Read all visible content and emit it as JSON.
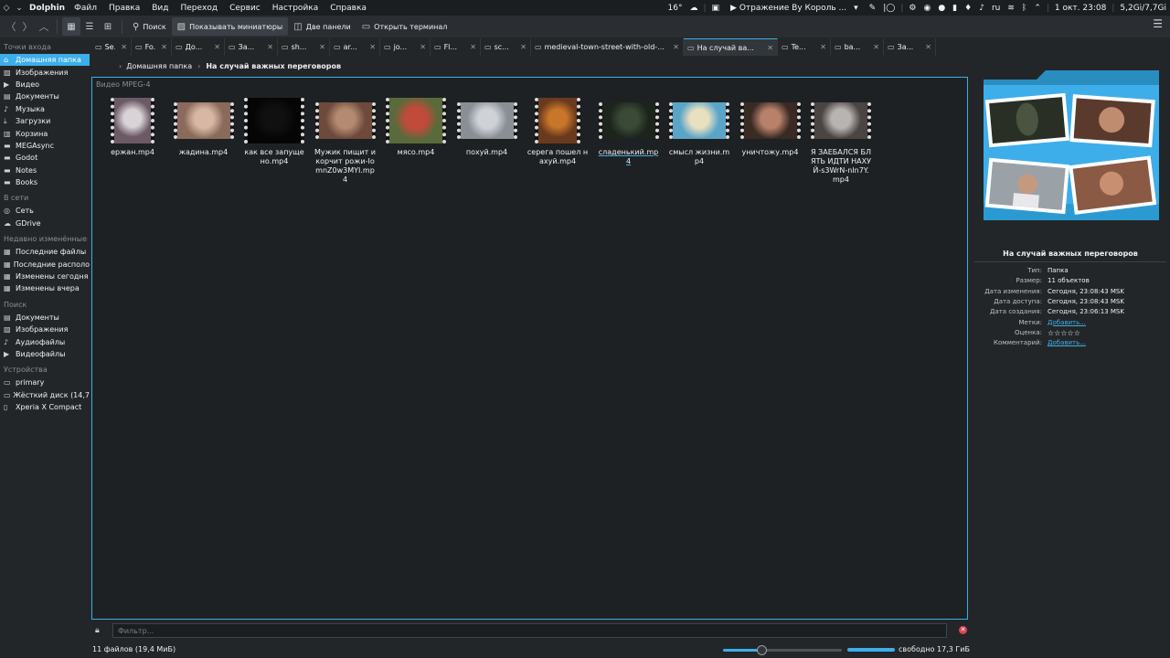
{
  "topbar": {
    "app_name": "Dolphin",
    "menus": [
      "Файл",
      "Правка",
      "Вид",
      "Переход",
      "Сервис",
      "Настройка",
      "Справка"
    ],
    "temperature": "16°",
    "media_title": "▶ Отражение By Король ...",
    "keyboard_layout": "ru",
    "datetime": "1 окт. 23:08",
    "memory": "5,2Gi/7,7Gi"
  },
  "toolbar": {
    "search_label": "Поиск",
    "thumbnails_label": "Показывать миниатюры",
    "split_label": "Две панели",
    "terminal_label": "Открыть терминал"
  },
  "sidebar": {
    "sections": [
      {
        "title": "Точки входа",
        "items": [
          {
            "label": "Домашняя папка",
            "icon": "home-icon",
            "selected": true
          },
          {
            "label": "Изображения",
            "icon": "image-icon"
          },
          {
            "label": "Видео",
            "icon": "video-icon"
          },
          {
            "label": "Документы",
            "icon": "document-icon"
          },
          {
            "label": "Музыка",
            "icon": "music-icon"
          },
          {
            "label": "Загрузки",
            "icon": "download-icon"
          },
          {
            "label": "Корзина",
            "icon": "trash-icon"
          },
          {
            "label": "MEGAsync",
            "icon": "folder-icon"
          },
          {
            "label": "Godot",
            "icon": "folder-icon"
          },
          {
            "label": "Notes",
            "icon": "folder-icon"
          },
          {
            "label": "Books",
            "icon": "folder-icon"
          }
        ]
      },
      {
        "title": "В сети",
        "items": [
          {
            "label": "Сеть",
            "icon": "network-icon"
          },
          {
            "label": "GDrive",
            "icon": "cloud-icon"
          }
        ]
      },
      {
        "title": "Недавно изменённые",
        "items": [
          {
            "label": "Последние файлы",
            "icon": "recent-files-icon"
          },
          {
            "label": "Последние располо",
            "icon": "recent-locations-icon"
          },
          {
            "label": "Изменены сегодня",
            "icon": "calendar-icon"
          },
          {
            "label": "Изменены вчера",
            "icon": "calendar-icon"
          }
        ]
      },
      {
        "title": "Поиск",
        "items": [
          {
            "label": "Документы",
            "icon": "document-icon"
          },
          {
            "label": "Изображения",
            "icon": "image-icon"
          },
          {
            "label": "Аудиофайлы",
            "icon": "music-icon"
          },
          {
            "label": "Видеофайлы",
            "icon": "video-icon"
          }
        ]
      },
      {
        "title": "Устройства",
        "items": [
          {
            "label": "primary",
            "icon": "drive-icon"
          },
          {
            "label": "Жёсткий диск (14,7",
            "icon": "drive-icon"
          },
          {
            "label": "Xperia X Compact",
            "icon": "phone-icon"
          }
        ]
      }
    ]
  },
  "tabs": [
    {
      "label": "Se...",
      "active": false
    },
    {
      "label": "Fo...",
      "active": false
    },
    {
      "label": "До...",
      "active": false
    },
    {
      "label": "За...",
      "active": false
    },
    {
      "label": "sh...",
      "active": false
    },
    {
      "label": "ar...",
      "active": false
    },
    {
      "label": "jo...",
      "active": false
    },
    {
      "label": "Fl...",
      "active": false
    },
    {
      "label": "sc...",
      "active": false
    },
    {
      "label": "medieval-town-street-with-old-...",
      "active": false
    },
    {
      "label": "На случай ва...",
      "active": true
    },
    {
      "label": "Te...",
      "active": false
    },
    {
      "label": "ba...",
      "active": false
    },
    {
      "label": "За...",
      "active": false
    }
  ],
  "breadcrumb": {
    "home": "Домашняя папка",
    "current": "На случай важных переговоров"
  },
  "main": {
    "group_label": "Видео MPEG-4",
    "files": [
      {
        "name": "ержан.mp4",
        "colors": [
          "#6b5a66",
          "#d9d2d6"
        ]
      },
      {
        "name": "жадина.mp4",
        "colors": [
          "#8a6a5a",
          "#d8b8a4"
        ]
      },
      {
        "name": "как все запущено.mp4",
        "colors": [
          "#050505",
          "#101010"
        ]
      },
      {
        "name": "Мужик пищит и корчит рожи-IomnZ0w3MYI.mp4",
        "colors": [
          "#6d4a3c",
          "#b58a72"
        ]
      },
      {
        "name": "мясо.mp4",
        "colors": [
          "#5a6a3a",
          "#c24a3a"
        ]
      },
      {
        "name": "похуй.mp4",
        "colors": [
          "#8a8f96",
          "#cfd3d8"
        ]
      },
      {
        "name": "серега пошел нахуй.mp4",
        "colors": [
          "#6a3a1e",
          "#c8762a"
        ]
      },
      {
        "name": "сладенький.mp4",
        "colors": [
          "#1c241c",
          "#3a4a36"
        ],
        "hover": true
      },
      {
        "name": "смысл жизни.mp4",
        "colors": [
          "#5aa4c8",
          "#e8e0c0"
        ]
      },
      {
        "name": "уничтожу.mp4",
        "colors": [
          "#3a2a24",
          "#b8826a"
        ]
      },
      {
        "name": "Я ЗАЕБАЛСЯ БЛЯТЬ ИДТИ НАХУЙ-s3WrN-nIn7Y.mp4",
        "colors": [
          "#4a4442",
          "#b8b4b2"
        ]
      }
    ]
  },
  "filter": {
    "placeholder": "Фильтр..."
  },
  "status": {
    "summary": "11 файлов (19,4 МиБ)",
    "free_space": "свободно 17,3 ГиБ",
    "zoom_fraction": 0.32,
    "free_fraction": 0.7
  },
  "info": {
    "title": "На случай важных переговоров",
    "rows": [
      {
        "label": "Тип:",
        "value": "Папка"
      },
      {
        "label": "Размер:",
        "value": "11 объектов"
      },
      {
        "label": "Дата изменения:",
        "value": "Сегодня, 23:08:43 MSK"
      },
      {
        "label": "Дата доступа:",
        "value": "Сегодня, 23:08:43 MSK"
      },
      {
        "label": "Дата создания:",
        "value": "Сегодня, 23:06:13 MSK"
      },
      {
        "label": "Метки:",
        "value": "Добавить...",
        "link": true
      },
      {
        "label": "Оценка:",
        "value": "☆☆☆☆☆",
        "stars": true
      },
      {
        "label": "Комментарий:",
        "value": "Добавить...",
        "link": true
      }
    ]
  },
  "colors": {
    "accent": "#3daee9",
    "background": "#232629",
    "view_background": "#1e2124",
    "folder_blue": "#3daee9"
  }
}
